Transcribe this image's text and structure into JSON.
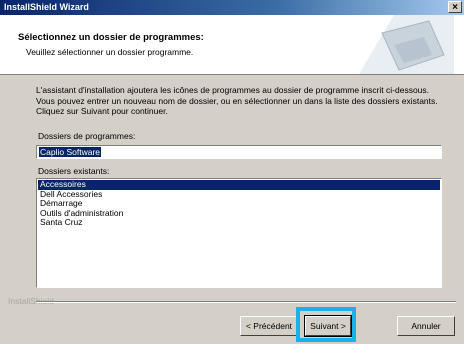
{
  "window": {
    "title": "InstallShield Wizard",
    "close_label": "×"
  },
  "header": {
    "title": "Sélectionnez un dossier de programmes:",
    "subtitle": "Veuillez sélectionner un dossier programme."
  },
  "description": "L'assistant d'installation ajoutera les icônes de programmes au dossier de programme inscrit ci-dessous. Vous pouvez entrer un nouveau nom de dossier, ou en sélectionner un dans la liste des dossiers existants. Cliquez sur Suivant pour continuer.",
  "program_folder": {
    "label": "Dossiers de programmes:",
    "value": "Caplio Software"
  },
  "existing_folders": {
    "label": "Dossiers existants:",
    "items": [
      "Accessoires",
      "Dell Accessories",
      "Démarrage",
      "Outils d'administration",
      "Santa Cruz"
    ],
    "selected": "Accessoires"
  },
  "footer": {
    "brand": "InstallShield",
    "back_label": "< Précédent",
    "next_label": "Suivant >",
    "cancel_label": "Annuler"
  }
}
